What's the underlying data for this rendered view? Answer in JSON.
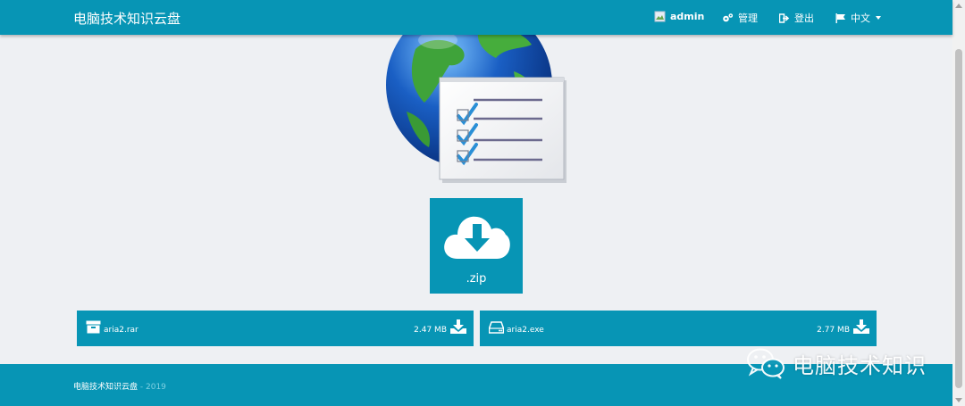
{
  "navbar": {
    "brand": "电脑技术知识云盘",
    "user": "admin",
    "admin_label": "管理",
    "logout_label": "登出",
    "language_label": "中文"
  },
  "main": {
    "download_ext": ".zip"
  },
  "files": [
    {
      "name": "aria2.rar",
      "size": "2.47 MB",
      "icon": "archive-icon"
    },
    {
      "name": "aria2.exe",
      "size": "2.77 MB",
      "icon": "drive-icon"
    }
  ],
  "footer": {
    "site": "电脑技术知识云盘",
    "year": "2019"
  },
  "watermark": {
    "text": "电脑技术知识"
  },
  "colors": {
    "primary": "#0795b5",
    "background": "#eef0f3"
  }
}
